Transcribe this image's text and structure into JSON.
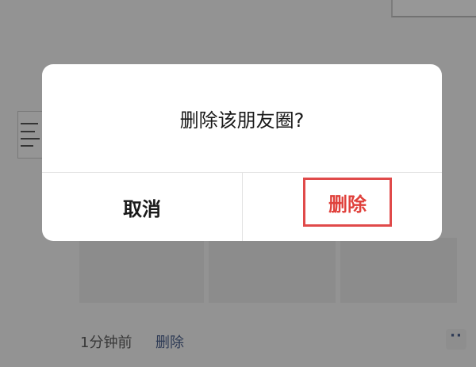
{
  "dialog": {
    "title": "删除该朋友圈?",
    "cancel_label": "取消",
    "confirm_label": "删除"
  },
  "feed": {
    "time_ago": "1分钟前",
    "delete_link": "删除",
    "more_icon": "ellipsis-icon"
  },
  "colors": {
    "confirm_text": "#e0413c",
    "highlight_box": "#e04a4a",
    "link": "#4b5f8a"
  }
}
